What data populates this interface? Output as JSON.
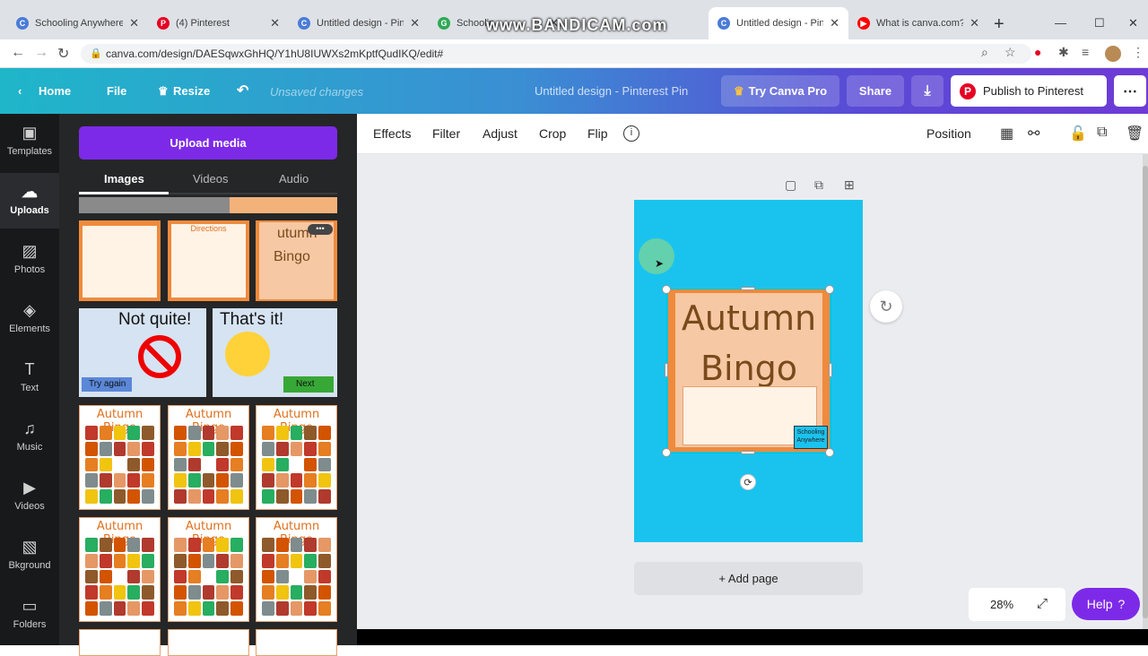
{
  "browser": {
    "tabs": [
      {
        "title": "Schooling Anywhere -",
        "favicon_color": "#4a7bd8",
        "favicon_letter": "C"
      },
      {
        "title": "(4) Pinterest",
        "favicon_color": "#e60023",
        "favicon_letter": "P"
      },
      {
        "title": "Untitled design - Pinte",
        "favicon_color": "#4a7bd8",
        "favicon_letter": "C"
      },
      {
        "title": "Schoolin",
        "favicon_color": "#2eaa55",
        "favicon_letter": "G"
      },
      {
        "title": "Untitled design - Pinte",
        "favicon_color": "#4a7bd8",
        "favicon_letter": "C"
      },
      {
        "title": "What is canva.com? (G",
        "favicon_color": "#ff0000",
        "favicon_letter": "▶"
      }
    ],
    "watermark": "www.BANDICAM.com",
    "url": "canva.com/design/DAESqwxGhHQ/Y1hU8IUWXs2mKptfQudIKQ/edit#"
  },
  "header": {
    "home": "Home",
    "file": "File",
    "resize": "Resize",
    "status": "Unsaved changes",
    "title": "Untitled design - Pinterest Pin",
    "try_pro": "Try Canva Pro",
    "share": "Share",
    "publish": "Publish to Pinterest"
  },
  "rail": [
    {
      "label": "Templates",
      "icon": "templates-icon",
      "glyph": "▣"
    },
    {
      "label": "Uploads",
      "icon": "upload-icon",
      "glyph": "☁"
    },
    {
      "label": "Photos",
      "icon": "photos-icon",
      "glyph": "▨"
    },
    {
      "label": "Elements",
      "icon": "elements-icon",
      "glyph": "◈"
    },
    {
      "label": "Text",
      "icon": "text-icon",
      "glyph": "T"
    },
    {
      "label": "Music",
      "icon": "music-icon",
      "glyph": "♫"
    },
    {
      "label": "Videos",
      "icon": "videos-icon",
      "glyph": "▶"
    },
    {
      "label": "Bkground",
      "icon": "background-icon",
      "glyph": "▧"
    },
    {
      "label": "Folders",
      "icon": "folder-icon",
      "glyph": "▭"
    }
  ],
  "panel": {
    "upload_button": "Upload media",
    "tabs": [
      "Images",
      "Videos",
      "Audio"
    ],
    "active_tab": "Images",
    "thumb_not_quite": "Not quite!",
    "thumb_try_again": "Try again",
    "thumb_thats_it": "That's it!",
    "thumb_next": "Next",
    "thumb_directions": "Directions",
    "bingo_title": "Autumn Bingo",
    "bingo_partial": "utumn"
  },
  "toolbar": {
    "effects": "Effects",
    "filter": "Filter",
    "adjust": "Adjust",
    "crop": "Crop",
    "flip": "Flip",
    "position": "Position"
  },
  "canvas": {
    "bg_color": "#1ac3ee",
    "image_title_line1": "Autumn",
    "image_title_line2": "Bingo",
    "logo_text": "Schooling Anywhere"
  },
  "footer": {
    "add_page": "+ Add page",
    "zoom": "28%",
    "help": "Help"
  }
}
